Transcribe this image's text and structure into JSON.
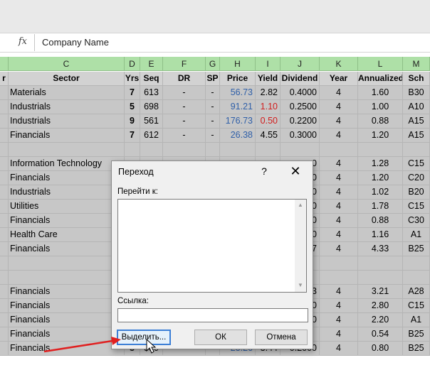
{
  "formula_bar": {
    "fx_label": "fx",
    "value": "Company Name"
  },
  "column_headers": [
    "C",
    "D",
    "E",
    "F",
    "G",
    "H",
    "I",
    "J",
    "K",
    "L",
    "M"
  ],
  "header_row": {
    "partial": "r",
    "sector": "Sector",
    "yrs": "Yrs",
    "seq": "Seq",
    "dr": "DR",
    "sp": "SP",
    "price": "Price",
    "yield": "Yield",
    "dividend": "Dividend",
    "year": "Year",
    "annualized": "Annualized",
    "sch": "Sch"
  },
  "rows": [
    {
      "sector": "Materials",
      "yrs": "7",
      "seq": "613",
      "dr": "-",
      "sp": "-",
      "price": "56.73",
      "yield": "2.82",
      "dividend": "0.4000",
      "year": "4",
      "annualized": "1.60",
      "sch": "B30"
    },
    {
      "sector": "Industrials",
      "yrs": "5",
      "seq": "698",
      "dr": "-",
      "sp": "-",
      "price": "91.21",
      "yield": "1.10",
      "dividend": "0.2500",
      "year": "4",
      "annualized": "1.00",
      "sch": "A10"
    },
    {
      "sector": "Industrials",
      "yrs": "9",
      "seq": "561",
      "dr": "-",
      "sp": "-",
      "price": "176.73",
      "yield": "0.50",
      "dividend": "0.2200",
      "year": "4",
      "annualized": "0.88",
      "sch": "A15"
    },
    {
      "sector": "Financials",
      "yrs": "7",
      "seq": "612",
      "dr": "-",
      "sp": "-",
      "price": "26.38",
      "yield": "4.55",
      "dividend": "0.3000",
      "year": "4",
      "annualized": "1.20",
      "sch": "A15"
    },
    {
      "sector": "",
      "yrs": "",
      "seq": "",
      "dr": "",
      "sp": "",
      "price": "",
      "yield": "",
      "dividend": "",
      "year": "",
      "annualized": "",
      "sch": ""
    },
    {
      "sector": "Information Technology",
      "yrs": "",
      "seq": "",
      "dr": "",
      "sp": "",
      "price": "",
      "yield": "",
      "dividend": "0",
      "year": "4",
      "annualized": "1.28",
      "sch": "C15"
    },
    {
      "sector": "Financials",
      "yrs": "",
      "seq": "",
      "dr": "",
      "sp": "",
      "price": "",
      "yield": "",
      "dividend": "0",
      "year": "4",
      "annualized": "1.20",
      "sch": "C20"
    },
    {
      "sector": "Industrials",
      "yrs": "",
      "seq": "",
      "dr": "",
      "sp": "",
      "price": "",
      "yield": "",
      "dividend": "0",
      "year": "4",
      "annualized": "1.02",
      "sch": "B20"
    },
    {
      "sector": "Utilities",
      "yrs": "",
      "seq": "",
      "dr": "",
      "sp": "",
      "price": "",
      "yield": "",
      "dividend": "0",
      "year": "4",
      "annualized": "1.78",
      "sch": "C15"
    },
    {
      "sector": "Financials",
      "yrs": "",
      "seq": "",
      "dr": "",
      "sp": "",
      "price": "",
      "yield": "",
      "dividend": "0",
      "year": "4",
      "annualized": "0.88",
      "sch": "C30"
    },
    {
      "sector": "Health Care",
      "yrs": "",
      "seq": "",
      "dr": "",
      "sp": "",
      "price": "",
      "yield": "",
      "dividend": "0",
      "year": "4",
      "annualized": "1.16",
      "sch": "A1"
    },
    {
      "sector": "Financials",
      "yrs": "",
      "seq": "",
      "dr": "",
      "sp": "",
      "price": "",
      "yield": "",
      "dividend": "7",
      "year": "4",
      "annualized": "4.33",
      "sch": "B25"
    },
    {
      "sector": "",
      "yrs": "",
      "seq": "",
      "dr": "",
      "sp": "",
      "price": "",
      "yield": "",
      "dividend": "",
      "year": "",
      "annualized": "",
      "sch": ""
    },
    {
      "sector": "",
      "yrs": "",
      "seq": "",
      "dr": "",
      "sp": "",
      "price": "",
      "yield": "",
      "dividend": "",
      "year": "",
      "annualized": "",
      "sch": ""
    },
    {
      "sector": "Financials",
      "yrs": "",
      "seq": "",
      "dr": "",
      "sp": "",
      "price": "",
      "yield": "",
      "dividend": "3",
      "year": "4",
      "annualized": "3.21",
      "sch": "A28"
    },
    {
      "sector": "Financials",
      "yrs": "",
      "seq": "",
      "dr": "",
      "sp": "",
      "price": "",
      "yield": "",
      "dividend": "0",
      "year": "4",
      "annualized": "2.80",
      "sch": "C15"
    },
    {
      "sector": "Financials",
      "yrs": "",
      "seq": "",
      "dr": "",
      "sp": "",
      "price": "",
      "yield": "",
      "dividend": "0",
      "year": "4",
      "annualized": "2.20",
      "sch": "A1"
    },
    {
      "sector": "Financials",
      "yrs": "",
      "seq": "",
      "dr": "",
      "sp": "",
      "price": "",
      "yield": "",
      "dividend": "",
      "year": "4",
      "annualized": "0.54",
      "sch": "B25"
    },
    {
      "sector": "Financials",
      "yrs": "8",
      "seq": "580",
      "dr": "-",
      "sp": "-",
      "price": "23.26",
      "yield": "3.44",
      "dividend": "0.2000",
      "year": "4",
      "annualized": "0.80",
      "sch": "B25"
    }
  ],
  "yield_red_rows": [
    1,
    2
  ],
  "dialog": {
    "title": "Переход",
    "help": "?",
    "close": "✕",
    "goto_label": "Перейти к:",
    "reference_label": "Ссылка:",
    "reference_value": "",
    "special_button": "Выделить...",
    "ok_button": "ОК",
    "cancel_button": "Отмена"
  },
  "colors": {
    "header_green": "#aee0a7",
    "row_gray": "#c7c7c7",
    "price_blue": "#2f5fa8",
    "yield_red": "#d11d1d",
    "arrow_red": "#e02020"
  }
}
